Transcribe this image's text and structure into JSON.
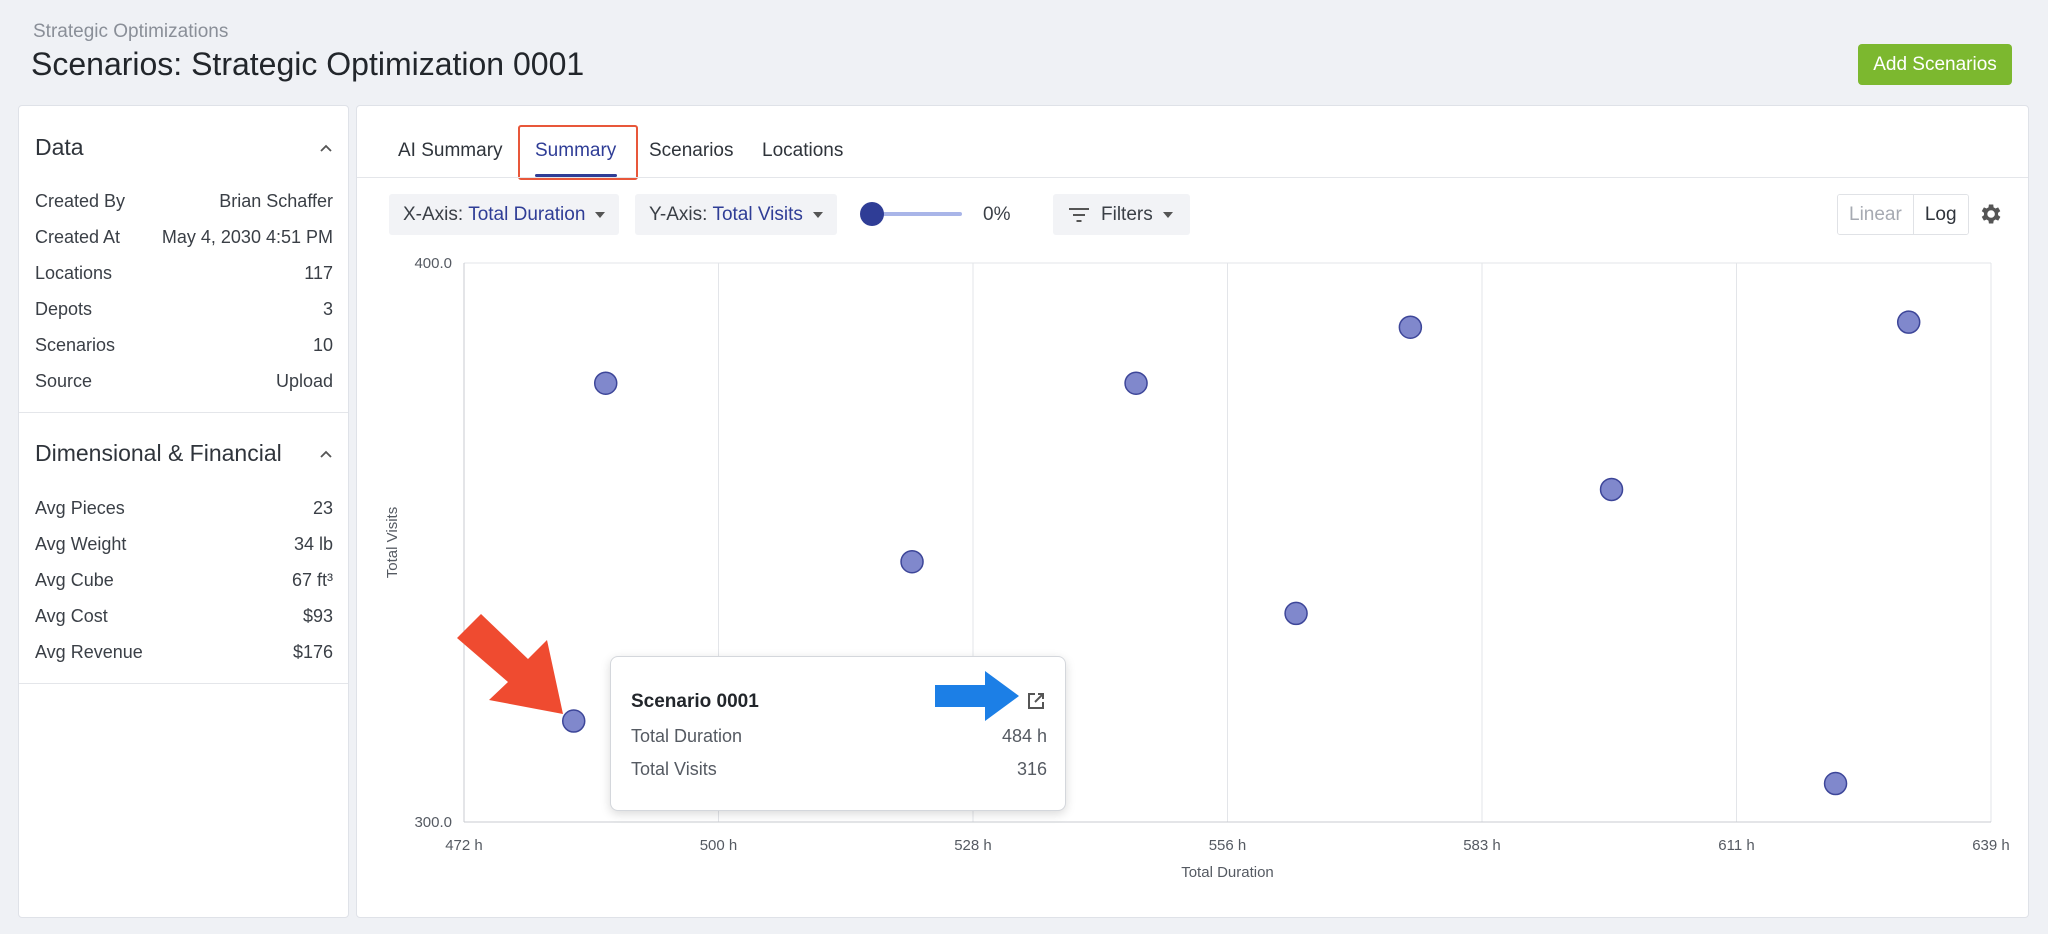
{
  "header": {
    "breadcrumb": "Strategic Optimizations",
    "title": "Scenarios: Strategic Optimization 0001",
    "add_button": "Add Scenarios"
  },
  "colors": {
    "accent": "#2f3d96",
    "brand_green": "#7cb82f",
    "highlight": "#e8573a",
    "point_fill": "#8088cc"
  },
  "sidebar": {
    "data": {
      "title": "Data",
      "rows": [
        {
          "k": "Created By",
          "v": "Brian Schaffer"
        },
        {
          "k": "Created At",
          "v": "May 4, 2030 4:51 PM"
        },
        {
          "k": "Locations",
          "v": "117"
        },
        {
          "k": "Depots",
          "v": "3"
        },
        {
          "k": "Scenarios",
          "v": "10"
        },
        {
          "k": "Source",
          "v": "Upload"
        }
      ]
    },
    "financial": {
      "title": "Dimensional & Financial",
      "rows": [
        {
          "k": "Avg Pieces",
          "v": "23"
        },
        {
          "k": "Avg Weight",
          "v": "34 lb"
        },
        {
          "k": "Avg Cube",
          "v": "67 ft³"
        },
        {
          "k": "Avg Cost",
          "v": "$93"
        },
        {
          "k": "Avg Revenue",
          "v": "$176"
        }
      ]
    }
  },
  "tabs": [
    {
      "label": "AI Summary"
    },
    {
      "label": "Summary"
    },
    {
      "label": "Scenarios"
    },
    {
      "label": "Locations"
    }
  ],
  "toolbar": {
    "x_axis_label": "X-Axis:",
    "x_axis_value": "Total Duration",
    "y_axis_label": "Y-Axis:",
    "y_axis_value": "Total Visits",
    "slider_value": "0%",
    "filters_label": "Filters",
    "scale_linear": "Linear",
    "scale_log": "Log",
    "active_scale": "Log"
  },
  "chart_data": {
    "type": "scatter",
    "xlabel": "Total Duration",
    "ylabel": "Total Visits",
    "x_ticks": [
      "472 h",
      "500 h",
      "528 h",
      "556 h",
      "583 h",
      "611 h",
      "639 h"
    ],
    "y_ticks": [
      "400.0",
      "300.0"
    ],
    "x_range": [
      472,
      639
    ],
    "y_range": [
      300,
      400
    ],
    "y_scale": "log",
    "grid": true,
    "points": [
      {
        "name": "Scenario 0001",
        "x": 484,
        "y": 316
      },
      {
        "x": 487.5,
        "y": 376
      },
      {
        "x": 521,
        "y": 343
      },
      {
        "x": 545.5,
        "y": 376
      },
      {
        "x": 563,
        "y": 334
      },
      {
        "x": 575.5,
        "y": 387
      },
      {
        "x": 597.5,
        "y": 356
      },
      {
        "x": 622,
        "y": 306
      },
      {
        "x": 630,
        "y": 388
      }
    ]
  },
  "tooltip": {
    "title": "Scenario 0001",
    "rows": [
      {
        "k": "Total Duration",
        "v": "484 h"
      },
      {
        "k": "Total Visits",
        "v": "316"
      }
    ]
  }
}
